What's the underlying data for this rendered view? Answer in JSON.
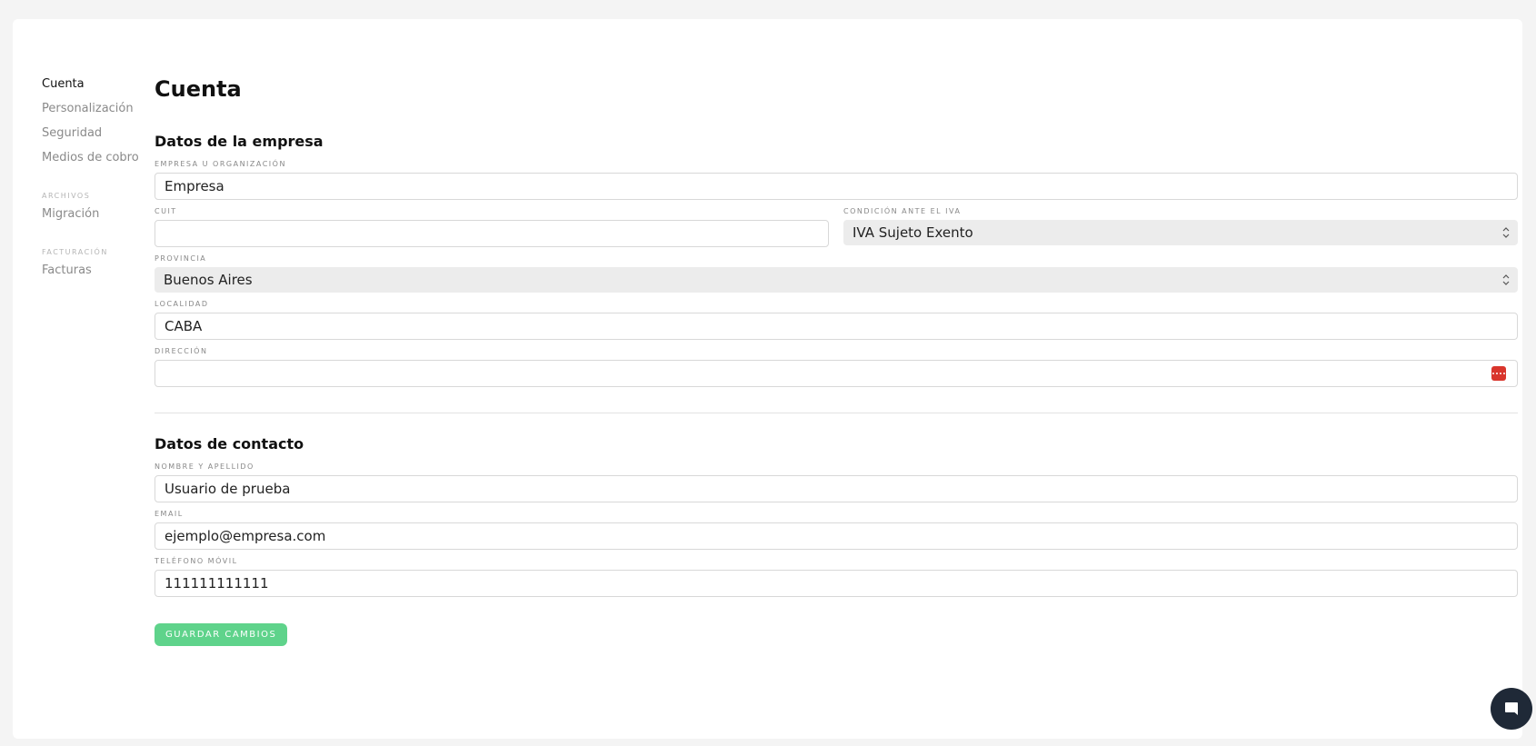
{
  "sidebar": {
    "items": [
      {
        "label": "Cuenta"
      },
      {
        "label": "Personalización"
      },
      {
        "label": "Seguridad"
      },
      {
        "label": "Medios de cobro"
      }
    ],
    "sections": [
      {
        "title": "ARCHIVOS",
        "items": [
          {
            "label": "Migración"
          }
        ]
      },
      {
        "title": "FACTURACIÓN",
        "items": [
          {
            "label": "Facturas"
          }
        ]
      }
    ]
  },
  "main": {
    "title": "Cuenta",
    "company": {
      "title": "Datos de la empresa",
      "organization": {
        "label": "EMPRESA U ORGANIZACIÓN",
        "value": "Empresa"
      },
      "cuit": {
        "label": "CUIT",
        "value": ""
      },
      "iva": {
        "label": "CONDICIÓN ANTE EL IVA",
        "value": "IVA Sujeto Exento"
      },
      "province": {
        "label": "PROVINCIA",
        "value": "Buenos Aires"
      },
      "locality": {
        "label": "LOCALIDAD",
        "value": "CABA"
      },
      "address": {
        "label": "DIRECCIÓN",
        "value": ""
      }
    },
    "contact": {
      "title": "Datos de contacto",
      "name": {
        "label": "NOMBRE Y APELLIDO",
        "value": "Usuario de prueba"
      },
      "email": {
        "label": "EMAIL",
        "value": "ejemplo@empresa.com"
      },
      "phone": {
        "label": "TELÉFONO MÓVIL",
        "value": "111111111111"
      }
    },
    "save_label": "GUARDAR CAMBIOS"
  },
  "colors": {
    "accent": "#5fd38b",
    "chat_bubble": "#1f2937",
    "password_manager_badge": "#d9352c"
  },
  "icons": {
    "chat": "chat-bubble-icon",
    "select": "chevron-up-down-icon",
    "address_autofill": "password-manager-icon"
  }
}
